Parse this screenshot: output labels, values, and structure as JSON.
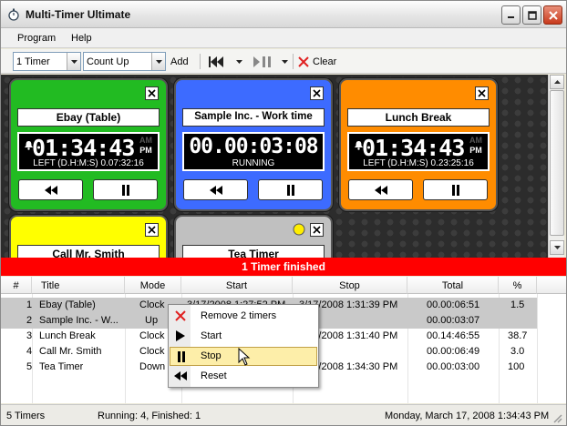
{
  "window": {
    "title": "Multi-Timer Ultimate"
  },
  "menu": {
    "items": [
      "Program",
      "Help"
    ]
  },
  "toolbar": {
    "timer_count": "1 Timer",
    "mode": "Count Up",
    "add_label": "Add",
    "clear_label": "Clear"
  },
  "timers": [
    {
      "name": "Ebay (Table)",
      "time": "01:34:43",
      "ampm": [
        "AM",
        "PM"
      ],
      "sub": "LEFT (D.H:M:S) 0.07:32:16",
      "color": "#22bb22",
      "playing": true
    },
    {
      "name": "Sample Inc. - Work time",
      "time": "00.00:03:08",
      "sub": "RUNNING",
      "color": "#3366ff",
      "playing": true,
      "warn": true
    },
    {
      "name": "Lunch Break",
      "time": "01:34:43",
      "ampm": [
        "AM",
        "PM"
      ],
      "sub": "LEFT (D.H:M:S) 0.23:25:16",
      "color": "#ff8c00",
      "playing": false
    },
    {
      "name": "Call Mr. Smith",
      "color": "#ffff00",
      "playing": false
    },
    {
      "name": "Tea Timer",
      "color": "#c0c0c0",
      "playing": false,
      "finished": true
    }
  ],
  "banner": "1 Timer finished",
  "table": {
    "headers": [
      "#",
      "Title",
      "Mode",
      "Start",
      "Stop",
      "Total",
      "%"
    ],
    "rows": [
      {
        "num": "1",
        "title": "Ebay (Table)",
        "mode": "Clock",
        "start": "3/17/2008 1:27:52 PM",
        "stop": "3/17/2008 1:31:39 PM",
        "total": "00.00:06:51",
        "pct": "1.5",
        "selected": true
      },
      {
        "num": "2",
        "title": "Sample Inc. - W...",
        "mode": "Up",
        "start": "",
        "stop": "",
        "total": "00.00:03:07",
        "pct": "",
        "selected": true
      },
      {
        "num": "3",
        "title": "Lunch Break",
        "mode": "Clock",
        "start": "",
        "stop": "3/17/2008 1:31:40 PM",
        "total": "00.14:46:55",
        "pct": "38.7",
        "selected": false
      },
      {
        "num": "4",
        "title": "Call Mr. Smith",
        "mode": "Clock",
        "start": "",
        "stop": "",
        "total": "00.00:06:49",
        "pct": "3.0",
        "selected": false
      },
      {
        "num": "5",
        "title": "Tea Timer",
        "mode": "Down",
        "start": "",
        "stop": "3/17/2008 1:34:30 PM",
        "total": "00.00:03:00",
        "pct": "100",
        "selected": false
      }
    ]
  },
  "context_menu": {
    "items": [
      "Remove 2 timers",
      "Start",
      "Stop",
      "Reset"
    ],
    "highlighted": "Stop"
  },
  "status": {
    "timers": "5 Timers",
    "running": "Running: 4, Finished: 1",
    "datetime": "Monday, March 17, 2008 1:34:43 PM"
  }
}
